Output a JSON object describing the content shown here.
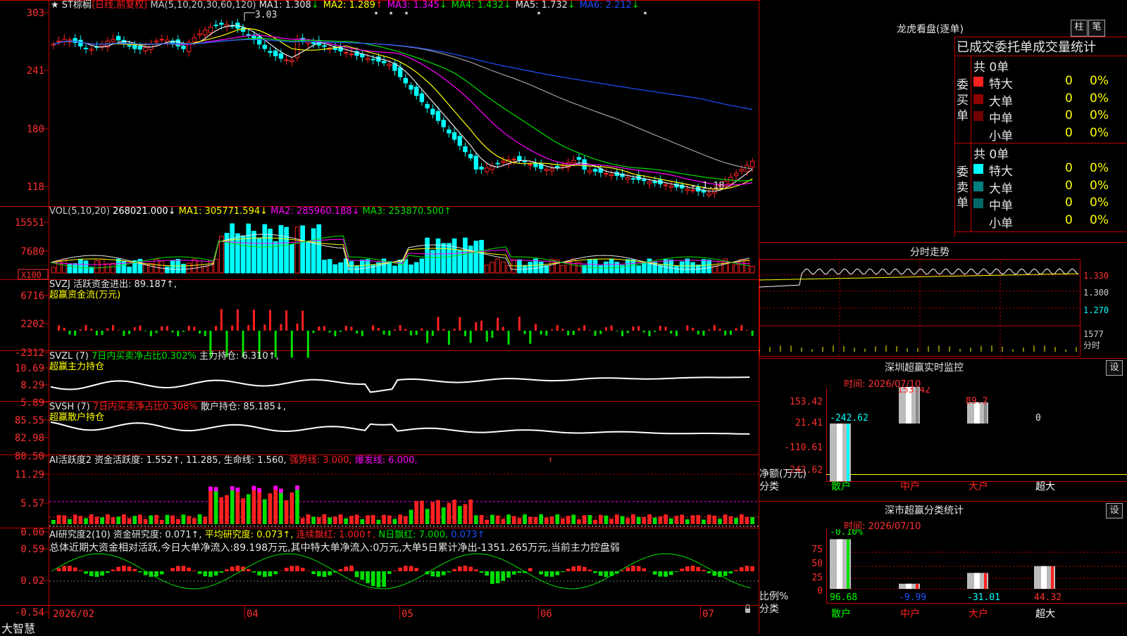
{
  "colors": {
    "up": "#ff2020",
    "down": "#00ffff",
    "green": "#00e000",
    "frame": "#c00000",
    "white": "#e6e6e6",
    "yellow": "#ffff00",
    "magenta": "#ff00ff",
    "blue": "#2050ff",
    "gray": "#a0a0a0"
  },
  "main_panel": {
    "title": "★ ST棕榈",
    "period_tag": "(日线,前复权)",
    "ma_params": "MA(5,10,20,30,60,120)",
    "ma_values": [
      {
        "label": "MA1:",
        "value": "1.308",
        "arrow": "↓",
        "color": "#e6e6e6"
      },
      {
        "label": "MA2:",
        "value": "1.289",
        "arrow": "↑",
        "color": "#ffff00"
      },
      {
        "label": "MA3:",
        "value": "1.345",
        "arrow": "↓",
        "color": "#ff00ff"
      },
      {
        "label": "MA4:",
        "value": "1.432",
        "arrow": "↓",
        "color": "#00e000"
      },
      {
        "label": "MA5:",
        "value": "1.732",
        "arrow": "↓",
        "color": "#e6e6e6"
      },
      {
        "label": "MA6:",
        "value": "2.212",
        "arrow": "↓",
        "color": "#2050ff"
      }
    ],
    "high_label": "3.03",
    "low_label": "1.18",
    "y_ticks": [
      "303",
      "241",
      "180",
      "118"
    ]
  },
  "vol_panel": {
    "label": "VOL(5,10,20)",
    "value": "268021.000↓",
    "ma1": "MA1: 305771.594↓",
    "ma2": "MA2: 285960.188↓",
    "ma3": "MA3: 253870.500↑",
    "y_ticks": [
      "15551",
      "7680"
    ],
    "unit": "X100"
  },
  "svzj_panel": {
    "label": "SVZJ  活跃资金进出: 89.187↑,",
    "sub": "超赢资金流(万元)",
    "y_ticks": [
      "6716",
      "2202",
      "-2312"
    ]
  },
  "svzl_panel": {
    "label": "SVZL (7)",
    "pct": "7日内买卖净占比0.302%",
    "hold": "主力持仓: 6.310↑,",
    "sub": "超赢主力持仓",
    "y_ticks": [
      "10.69",
      "8.29",
      "5.89"
    ]
  },
  "svsh_panel": {
    "label": "SVSH (7)",
    "pct": "7日内买卖净占比0.308%",
    "hold": "散户持仓: 85.185↓,",
    "sub": "超赢散户持仓",
    "y_ticks": [
      "85.55",
      "82.98",
      "80.50"
    ]
  },
  "ai1_panel": {
    "label": "AI活跃度2 资金活跃度: 1.552↑, 11.285, 生命线: 1.560,",
    "strong": "强势线: 3.000,",
    "burst": "爆发线: 6.000,",
    "y_ticks": [
      "11.29",
      "5.57",
      "0.00"
    ]
  },
  "ai2_panel": {
    "label": "AI研究度2(10) 资金研究度: 0.071↑,",
    "avg": "平均研究度: 0.073↑,",
    "streak": "连续飘红: 1.000↑,",
    "nday": "N日飘红: 7.000,",
    "last": "0.073↑",
    "summary": "总体近期大资金相对活跃,今日大单净流入:89.198万元,其中特大单净流入:0万元,大单5日累计净出-1351.265万元,当前主力控盘弱",
    "y_ticks": [
      "0.59",
      "0.02",
      "-0.54"
    ]
  },
  "date_axis": {
    "brand": "大智慧",
    "labels": [
      "2026/02",
      "04",
      "05",
      "06",
      "07"
    ]
  },
  "right_panel": {
    "longhu_title": "龙虎看盘(逐单)",
    "btn_zhu": "柱",
    "btn_bi": "笔",
    "stats_title": "已成交委托单成交量统计",
    "buy_label": "委买单",
    "sell_label": "委卖单",
    "buy_total": "共 0单",
    "sell_total": "共 0单",
    "buy_rows": [
      {
        "name": "特大",
        "value": "0",
        "pct": "0%",
        "color": "#ff2020"
      },
      {
        "name": "大单",
        "value": "0",
        "pct": "0%",
        "color": "#900000"
      },
      {
        "name": "中单",
        "value": "0",
        "pct": "0%",
        "color": "#700000"
      },
      {
        "name": "小单",
        "value": "0",
        "pct": "0%",
        "color": "#000000"
      }
    ],
    "sell_rows": [
      {
        "name": "特大",
        "value": "0",
        "pct": "0%",
        "color": "#00ffff"
      },
      {
        "name": "大单",
        "value": "0",
        "pct": "0%",
        "color": "#008080"
      },
      {
        "name": "中单",
        "value": "0",
        "pct": "0%",
        "color": "#006868"
      },
      {
        "name": "小单",
        "value": "0",
        "pct": "0%",
        "color": "#000000"
      }
    ],
    "fenshi_title": "分时走势",
    "fenshi_ticks": [
      "1.330",
      "1.300",
      "1.270",
      "1577",
      "分时"
    ],
    "monitor_title": "深圳超赢实时监控",
    "monitor_time": "时间: 2026/07/10",
    "monitor_btn": "设",
    "monitor_ticks": [
      "153.42",
      "21.41",
      "-110.61",
      "-242.62"
    ],
    "monitor_axis": [
      "净额(万元)",
      "分类"
    ],
    "class_title": "深市超赢分类统计",
    "class_time": "时间: 2026/07/10",
    "class_btn": "设",
    "class_ticks": [
      "75",
      "50",
      "25",
      "0"
    ],
    "class_axis": [
      "比例%",
      "分类"
    ],
    "categories": [
      {
        "name": "散户",
        "color": "#00ff00"
      },
      {
        "name": "中户",
        "color": "#ff2020"
      },
      {
        "name": "大户",
        "color": "#ff2020"
      },
      {
        "name": "超大",
        "color": "#ffffff"
      }
    ]
  },
  "chart_data": [
    {
      "type": "bar",
      "title": "深圳超赢实时监控",
      "categories": [
        "散户",
        "中户",
        "大户",
        "超大"
      ],
      "values": [
        -242.62,
        153.42,
        89.2,
        0
      ],
      "ylim": [
        -242.62,
        153.42
      ],
      "ylabel": "净额(万元)",
      "xlabel": "分类"
    },
    {
      "type": "bar",
      "title": "深市超赢分类统计",
      "categories": [
        "散户",
        "中户",
        "大户",
        "超大"
      ],
      "values": [
        96.68,
        -9.99,
        -31.01,
        44.32
      ],
      "extra_labels": [
        "-0.10%"
      ],
      "ylim": [
        0,
        100
      ],
      "ylabel": "比例%",
      "xlabel": "分类"
    },
    {
      "type": "line",
      "title": "ST棕榈 (日线,前复权)",
      "x": [
        "2026/02",
        "04",
        "05",
        "06",
        "07"
      ],
      "ylim": [
        1.18,
        3.03
      ],
      "series": [
        {
          "name": "MA1",
          "values": [
            2.7,
            2.65,
            2.8,
            1.6,
            1.5,
            1.35,
            1.31
          ]
        },
        {
          "name": "MA2",
          "values": [
            2.68,
            2.66,
            2.78,
            1.7,
            1.52,
            1.38,
            1.29
          ]
        },
        {
          "name": "MA3",
          "values": [
            2.66,
            2.68,
            2.75,
            1.95,
            1.6,
            1.42,
            1.345
          ]
        },
        {
          "name": "MA4",
          "values": [
            2.62,
            2.66,
            2.72,
            2.25,
            1.75,
            1.55,
            1.432
          ]
        },
        {
          "name": "MA5",
          "values": [
            2.58,
            2.64,
            2.7,
            2.55,
            2.3,
            2.0,
            1.732
          ]
        },
        {
          "name": "MA6",
          "values": [
            2.55,
            2.58,
            2.62,
            2.55,
            2.45,
            2.32,
            2.212
          ]
        }
      ]
    }
  ]
}
